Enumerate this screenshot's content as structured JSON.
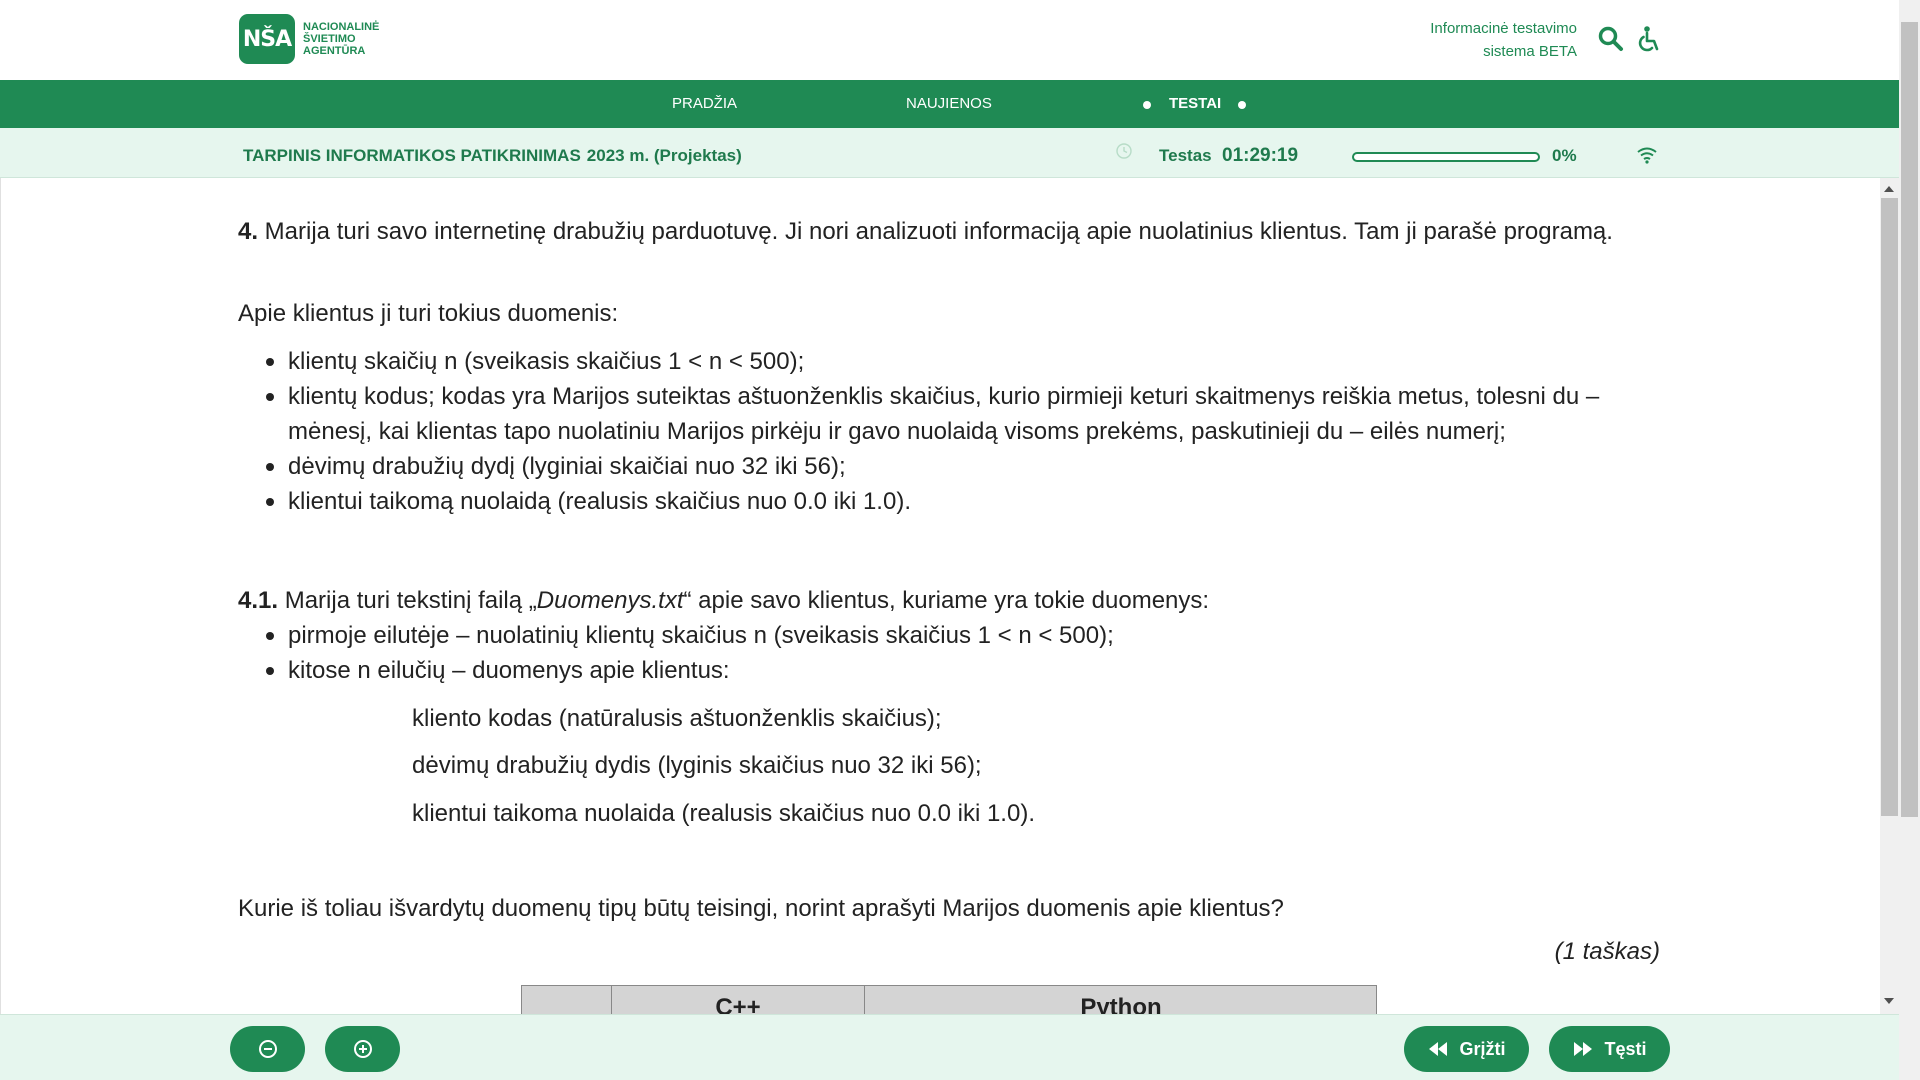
{
  "header": {
    "logo_mark": "NŠA",
    "logo_text": "Nacionalinė švietimo agentūra",
    "system_title_line1": "Informacinė testavimo",
    "system_title_line2": "sistema BETA",
    "icons": [
      "search-icon",
      "accessibility-icon"
    ]
  },
  "nav": {
    "items": [
      "PRADŽIA",
      "NAUJIENOS",
      "TESTAI"
    ]
  },
  "infobar": {
    "exam_title": "TARPINIS INFORMATIKOS PATIKRINIMAS",
    "exam_year": "2023 m. (Projektas)",
    "timer_label": "Testas",
    "timer_value": "01:29:19",
    "progress_percent": 0,
    "progress_label": "0%"
  },
  "question": {
    "num": "4.",
    "intro": " Marija turi savo internetinę drabužių parduotuvę. Ji nori analizuoti informaciją apie nuolatinius klientus. Tam ji parašė programą.",
    "data_intro": "Apie klientus ji turi tokius duomenis:",
    "bullets": [
      "klientų skaičių n (sveikasis skaičius 1 < n < 500);",
      "klientų kodus; kodas yra Marijos suteiktas aštuonženklis skaičius, kurio pirmieji keturi skaitmenys reiškia metus, tolesni du – mėnesį, kai klientas tapo nuolatiniu Marijos pirkėju ir gavo nuolaidą visoms prekėms, paskutinieji du – eilės numerį;",
      "dėvimų drabužių dydį (lyginiai skaičiai nuo 32 iki 56);",
      "klientui taikomą nuolaidą (realusis skaičius nuo 0.0 iki 1.0)."
    ],
    "sub_num": "4.1.",
    "sub_intro_a": "  Marija turi tekstinį failą „",
    "sub_intro_file": "Duomenys.txt",
    "sub_intro_b": "“ apie savo klientus, kuriame yra tokie duomenys:",
    "sub_bullets": [
      "pirmoje eilutėje – nuolatinių klientų skaičius n (sveikasis skaičius 1 < n < 500);",
      "kitose n eilučių – duomenys apie klientus:"
    ],
    "indented": [
      "kliento kodas (natūralusis aštuonženklis skaičius);",
      "dėvimų drabužių dydis (lyginis skaičius nuo 32 iki 56);",
      "klientui taikoma nuolaida (realusis skaičius nuo 0.0 iki 1.0)."
    ],
    "prompt": "Kurie iš toliau išvardytų duomenų tipų būtų teisingi, norint aprašyti Marijos duomenis apie klientus?",
    "points": "(1 taškas)",
    "table_headers": [
      "",
      "C++",
      "Python"
    ]
  },
  "footer": {
    "zoom_out_icon": "zoom-out-icon",
    "zoom_in_icon": "zoom-in-icon",
    "back_label": "Grįžti",
    "next_label": "Tęsti"
  },
  "colors": {
    "brand_green": "#1f8a54",
    "light_green_bg": "#e6f6ee"
  }
}
